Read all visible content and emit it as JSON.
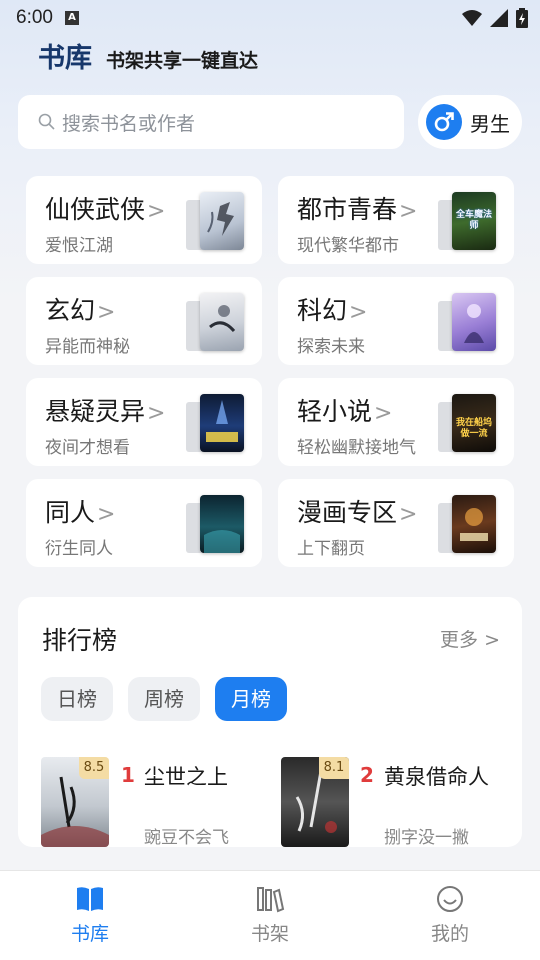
{
  "status_bar": {
    "time": "6:00",
    "notif_letter": "A"
  },
  "header": {
    "title": "书库",
    "slogan": "书架共享一键直达"
  },
  "search": {
    "placeholder": "搜索书名或作者"
  },
  "gender": {
    "label": "男生",
    "icon": "male-icon"
  },
  "categories": [
    {
      "name": "仙侠武侠",
      "sub": "爱恨江湖",
      "cover_text": ""
    },
    {
      "name": "都市青春",
      "sub": "现代繁华都市",
      "cover_text": "全车魔法师"
    },
    {
      "name": "玄幻",
      "sub": "异能而神秘",
      "cover_text": ""
    },
    {
      "name": "科幻",
      "sub": "探索未来",
      "cover_text": ""
    },
    {
      "name": "悬疑灵异",
      "sub": "夜间才想看",
      "cover_text": ""
    },
    {
      "name": "轻小说",
      "sub": "轻松幽默接地气",
      "cover_text": "我在船坞做一流"
    },
    {
      "name": "同人",
      "sub": "衍生同人",
      "cover_text": ""
    },
    {
      "name": "漫画专区",
      "sub": "上下翻页",
      "cover_text": ""
    }
  ],
  "chevron": ">",
  "ranking": {
    "title": "排行榜",
    "more": "更多",
    "tabs": [
      "日榜",
      "周榜",
      "月榜"
    ],
    "active_tab": 2,
    "books": [
      {
        "rank": "1",
        "title": "尘世之上",
        "author": "豌豆不会飞",
        "score": "8.5"
      },
      {
        "rank": "2",
        "title": "黄泉借命人",
        "author": "捌字没一撇",
        "score": "8.1"
      }
    ]
  },
  "nav": {
    "items": [
      "书库",
      "书架",
      "我的"
    ],
    "active": 0
  },
  "colors": {
    "accent": "#1e7ef0",
    "rank_red": "#e03c3c",
    "header_blue": "#17376b"
  }
}
